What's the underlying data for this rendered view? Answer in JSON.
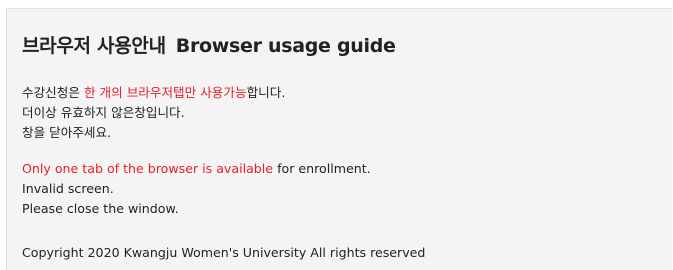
{
  "title": {
    "korean": "브라우저 사용안내",
    "english": "Browser usage guide"
  },
  "korean_notice": {
    "line1_prefix": "수강신청은 ",
    "line1_highlight": "한 개의 브라우저탭만 사용가능",
    "line1_suffix": "합니다.",
    "line2": "더이상 유효하지 않은창입니다.",
    "line3": "창을 닫아주세요."
  },
  "english_notice": {
    "line1_highlight": "Only one tab of the browser is available",
    "line1_suffix": " for enrollment.",
    "line2": "Invalid screen.",
    "line3": "Please close the window."
  },
  "footer": {
    "copyright": "Copyright 2020 Kwangju Women's University All rights reserved"
  },
  "colors": {
    "highlight": "#e8202a",
    "background": "#f4f4f4",
    "text": "#222222"
  }
}
